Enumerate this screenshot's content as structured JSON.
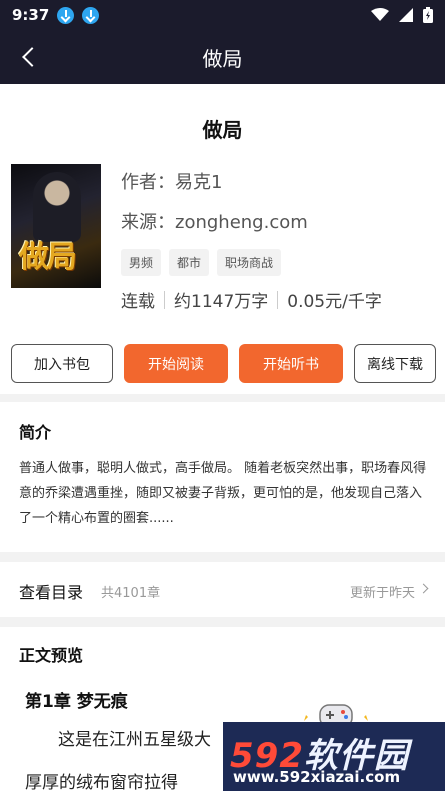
{
  "status_bar": {
    "time": "9:37"
  },
  "nav": {
    "title": "做局"
  },
  "book": {
    "title": "做局",
    "author": "作者：易克1",
    "source": "来源：zongheng.com",
    "tags": [
      "男频",
      "都市",
      "职场商战"
    ],
    "status": "连载",
    "word_count": "约1147万字",
    "price": "0.05元/千字",
    "cover_title": "做局"
  },
  "actions": {
    "add_to_shelf": "加入书包",
    "start_reading": "开始阅读",
    "start_listening": "开始听书",
    "offline_download": "离线下载"
  },
  "intro": {
    "title": "简介",
    "text": "普通人做事，聪明人做式，高手做局。 随着老板突然出事，职场春风得意的乔梁遭遇重挫，随即又被妻子背叛，更可怕的是，他发现自己落入了一个精心布置的圈套......"
  },
  "toc": {
    "label": "查看目录",
    "count": "共4101章",
    "update": "更新于昨天"
  },
  "preview": {
    "title": "正文预览",
    "chapter": "第1章 梦无痕",
    "line1": "这是在江州五星级大",
    "line2": "厚厚的绒布窗帘拉得"
  },
  "watermark": {
    "brand_num": "592",
    "brand_text": "软件园",
    "url": "www.592xiazai.com"
  },
  "colors": {
    "header_bg": "#1b1b2c",
    "accent": "#f2672e",
    "download_icon": "#2ea6f0"
  }
}
